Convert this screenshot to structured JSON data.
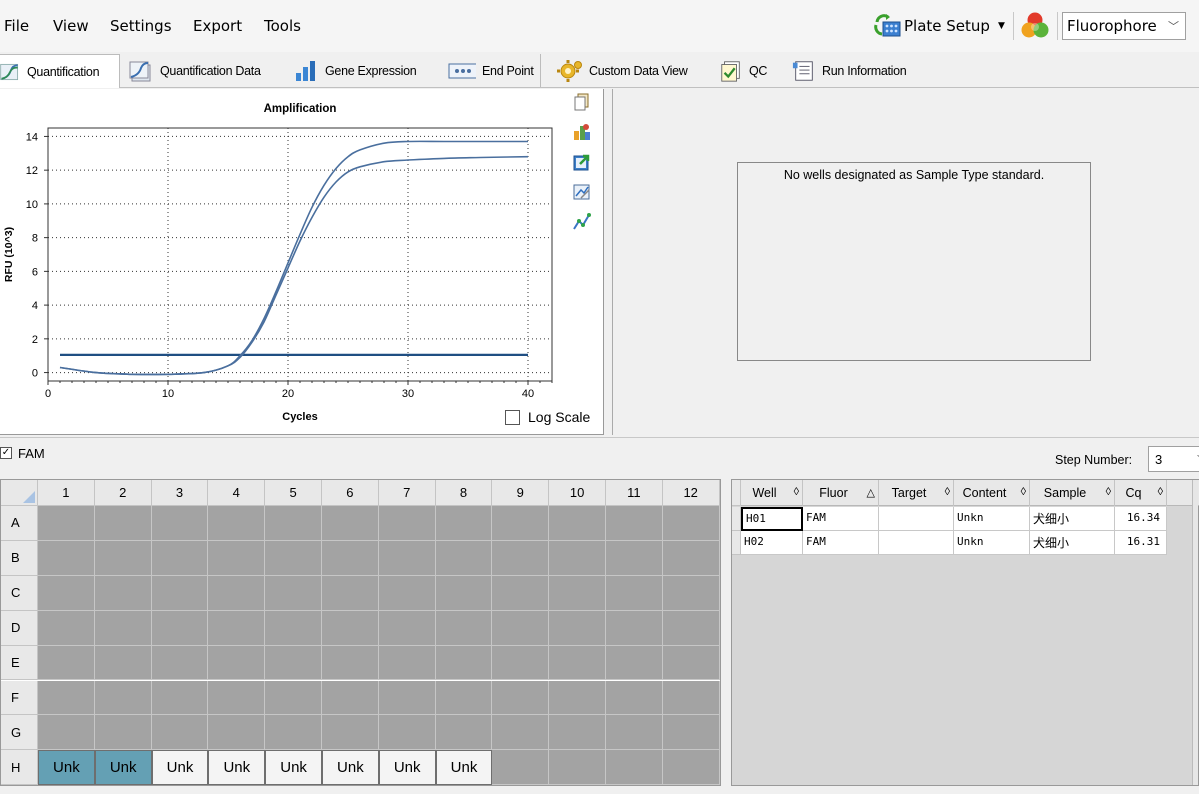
{
  "menu": {
    "file": "File",
    "view": "View",
    "settings": "Settings",
    "export": "Export",
    "tools": "Tools",
    "plate_setup": "Plate Setup",
    "fluorophore": "Fluorophore"
  },
  "tabs": [
    {
      "label": "Quantification",
      "icon": "quantification-icon"
    },
    {
      "label": "Quantification Data",
      "icon": "quantification-data-icon"
    },
    {
      "label": "Gene Expression",
      "icon": "gene-expression-icon"
    },
    {
      "label": "End Point",
      "icon": "end-point-icon"
    },
    {
      "label": "Custom Data View",
      "icon": "custom-data-view-icon"
    },
    {
      "label": "QC",
      "icon": "qc-icon"
    },
    {
      "label": "Run Information",
      "icon": "run-information-icon"
    }
  ],
  "chart_data": {
    "type": "line",
    "title": "Amplification",
    "xlabel": "Cycles",
    "ylabel": "RFU (10^3)",
    "xlim": [
      0,
      42
    ],
    "ylim": [
      -0.5,
      14.5
    ],
    "xticks": [
      0,
      10,
      20,
      30,
      40
    ],
    "yticks": [
      0,
      2,
      4,
      6,
      8,
      10,
      12,
      14
    ],
    "grid": "dotted",
    "x": [
      1,
      4,
      7,
      10,
      13,
      15,
      16,
      17,
      18,
      19,
      20,
      21,
      22,
      23,
      24,
      25,
      26,
      28,
      30,
      33,
      36,
      40
    ],
    "series": [
      {
        "name": "",
        "color": "#4a6f9e",
        "values": [
          0.3,
          0.0,
          -0.1,
          -0.1,
          0.0,
          0.4,
          1.0,
          1.9,
          3.2,
          4.8,
          6.5,
          8.2,
          9.8,
          11.1,
          12.1,
          12.8,
          13.2,
          13.6,
          13.7,
          13.7,
          13.7,
          13.7
        ]
      },
      {
        "name": "",
        "color": "#4a6f9e",
        "values": [
          0.3,
          0.0,
          -0.1,
          -0.1,
          0.0,
          0.4,
          0.9,
          1.8,
          3.0,
          4.6,
          6.2,
          7.8,
          9.2,
          10.4,
          11.3,
          11.9,
          12.2,
          12.5,
          12.6,
          12.7,
          12.75,
          12.8
        ]
      }
    ],
    "threshold": {
      "value": 1.05,
      "color": "#1f4e82"
    },
    "log_scale_label": "Log Scale",
    "log_scale_checked": false
  },
  "side_tools": [
    "copy-icon",
    "chart-palette-icon",
    "export-icon",
    "zoom-icon",
    "trace-icon"
  ],
  "std_curve": {
    "message": "No wells designated as Sample Type standard."
  },
  "fluor_filter": {
    "label": "FAM",
    "checked": true
  },
  "step": {
    "label": "Step Number:",
    "value": "3"
  },
  "plate": {
    "columns": [
      "1",
      "2",
      "3",
      "4",
      "5",
      "6",
      "7",
      "8",
      "9",
      "10",
      "11",
      "12"
    ],
    "rows": [
      "A",
      "B",
      "C",
      "D",
      "E",
      "F",
      "G",
      "H"
    ],
    "row_h_wells": [
      "Unk",
      "Unk",
      "Unk",
      "Unk",
      "Unk",
      "Unk",
      "Unk",
      "Unk"
    ],
    "selected_wells": [
      "H1",
      "H2"
    ]
  },
  "table": {
    "headers": [
      "Well",
      "Fluor",
      "Target",
      "Content",
      "Sample",
      "Cq"
    ],
    "sort_marks": [
      "◊",
      "△",
      "◊",
      "◊",
      "◊",
      "◊"
    ],
    "rows": [
      {
        "well": "H01",
        "fluor": "FAM",
        "target": "",
        "content": "Unkn",
        "sample": "犬细小",
        "cq": "16.34"
      },
      {
        "well": "H02",
        "fluor": "FAM",
        "target": "",
        "content": "Unkn",
        "sample": "犬细小",
        "cq": "16.31"
      }
    ]
  }
}
